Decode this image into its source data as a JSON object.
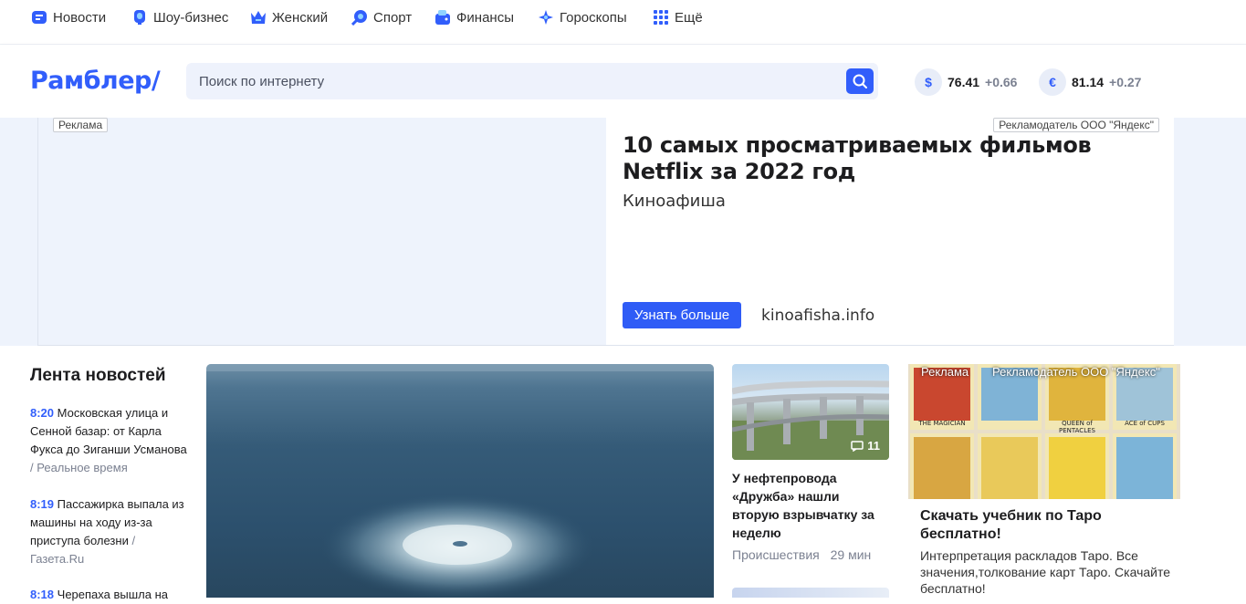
{
  "nav": {
    "items": [
      {
        "label": "Новости",
        "icon": "news-icon",
        "color": "#315efb"
      },
      {
        "label": "Шоу-бизнес",
        "icon": "microphone-icon",
        "color": "#315efb"
      },
      {
        "label": "Женский",
        "icon": "crown-icon",
        "color": "#315efb"
      },
      {
        "label": "Спорт",
        "icon": "ball-icon",
        "color": "#315efb"
      },
      {
        "label": "Финансы",
        "icon": "wallet-icon",
        "color": "#315efb"
      },
      {
        "label": "Гороскопы",
        "icon": "star-icon",
        "color": "#315efb"
      },
      {
        "label": "Ещё",
        "icon": "grid-icon",
        "color": "#315efb"
      }
    ]
  },
  "header": {
    "logo": "Рамблер/",
    "search_placeholder": "Поиск по интернету",
    "currencies": [
      {
        "symbol": "$",
        "value": "76.41",
        "change": "+0.66"
      },
      {
        "symbol": "€",
        "value": "81.14",
        "change": "+0.27"
      }
    ]
  },
  "ad_banner": {
    "tag": "Реклама",
    "advertiser": "Рекламодатель ООО \"Яндекс\"",
    "title": "10 самых просматриваемых фильмов Netflix за 2022 год",
    "source": "Киноафиша",
    "button": "Узнать больше",
    "domain": "kinoafisha.info"
  },
  "feed": {
    "title": "Лента новостей",
    "items": [
      {
        "time": "8:20",
        "text": "Московская улица и Сенной базар: от Карла Фукса до Зиганши Усманова",
        "source": "Реальное время"
      },
      {
        "time": "8:19",
        "text": "Пассажирка выпала из машины на ходу из-за приступа болезни",
        "source": "Газета.Ru"
      },
      {
        "time": "8:18",
        "text": "Черепаха вышла на",
        "source": ""
      }
    ]
  },
  "news_card": {
    "comments": "11",
    "title": "У нефтепровода «Дружба» нашли вторую взрывчатку за неделю",
    "category": "Происшествия",
    "time": "29 мин"
  },
  "tarot_ad": {
    "tag": "Реклама",
    "advertiser": "Рекламодатель ООО \"Яндекс\"",
    "card_labels": [
      "THE MAGICIAN",
      "QUEEN of PENTACLES",
      "ACE of CUPS"
    ],
    "title": "Скачать учебник по Таро бесплатно!",
    "text": "Интерпретация раскладов Таро. Все значения,толкование карт Таро. Скачайте бесплатно!"
  }
}
